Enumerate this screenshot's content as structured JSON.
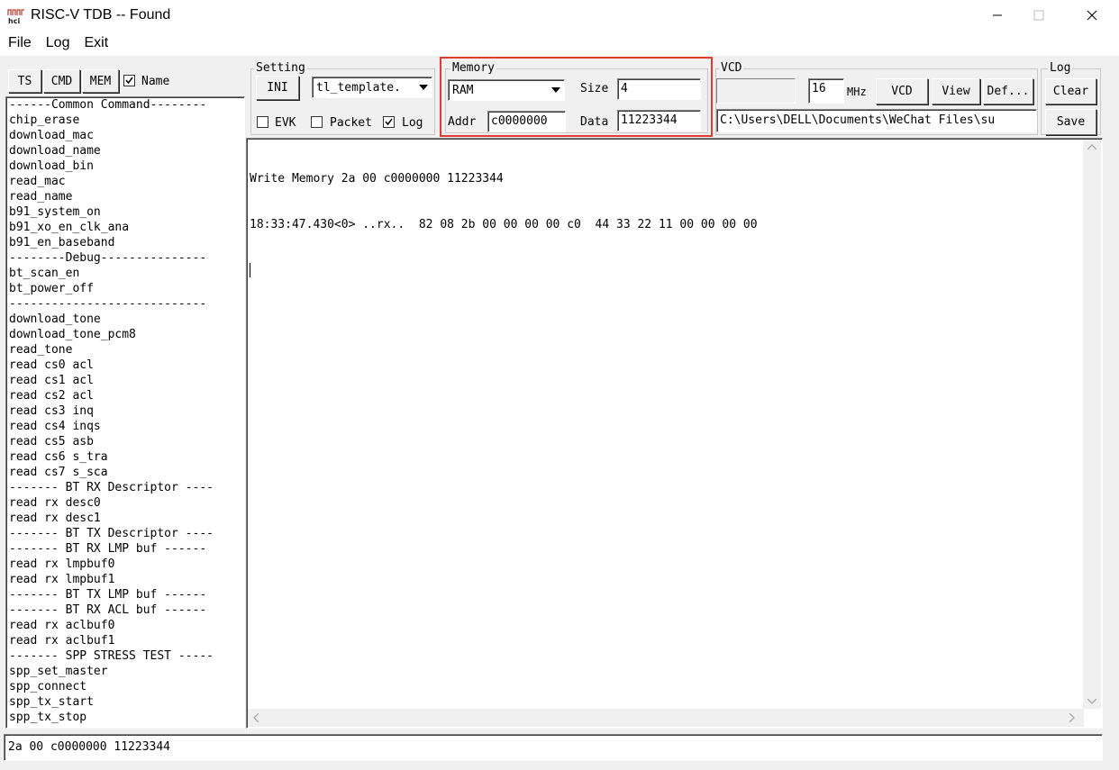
{
  "window": {
    "title": "RISC-V TDB -- Found",
    "icon": "hci-logo-icon",
    "controls": [
      "minimize-icon",
      "maximize-icon",
      "close-icon"
    ]
  },
  "menu": {
    "items": [
      "File",
      "Log",
      "Exit"
    ]
  },
  "left_panel": {
    "tabs": [
      "TS",
      "CMD",
      "MEM"
    ],
    "name_checkbox": {
      "label": "Name",
      "checked": true
    },
    "commands": [
      "------Common Command--------",
      "chip_erase",
      "download_mac",
      "download_name",
      "download_bin",
      "read_mac",
      "read_name",
      "b91_system_on",
      "b91_xo_en_clk_ana",
      "b91_en_baseband",
      "--------Debug---------------",
      "bt_scan_en",
      "bt_power_off",
      "----------------------------",
      "download_tone",
      "download_tone_pcm8",
      "read_tone",
      "read cs0 acl",
      "read cs1 acl",
      "read cs2 acl",
      "read cs3 inq",
      "read cs4 inqs",
      "read cs5 asb",
      "read cs6 s_tra",
      "read cs7 s_sca",
      "------- BT RX Descriptor ----",
      "read rx desc0",
      "read rx desc1",
      "------- BT TX Descriptor ----",
      "------- BT RX LMP buf ------",
      "read rx lmpbuf0",
      "read rx lmpbuf1",
      "------- BT TX LMP buf ------",
      "------- BT RX ACL buf ------",
      "read rx aclbuf0",
      "read rx aclbuf1",
      "------- SPP STRESS TEST -----",
      "spp_set_master",
      "spp_connect",
      "spp_tx_start",
      "spp_tx_stop"
    ]
  },
  "setting": {
    "label": "Setting",
    "ini_button": "INI",
    "template_value": "tl_template.",
    "evk": {
      "label": "EVK",
      "checked": false
    },
    "packet": {
      "label": "Packet",
      "checked": false
    },
    "log": {
      "label": "Log",
      "checked": true
    }
  },
  "memory": {
    "label": "Memory",
    "type_value": "RAM",
    "size_label": "Size",
    "size_value": "4",
    "addr_label": "Addr",
    "addr_value": "c0000000",
    "data_label": "Data",
    "data_value": "11223344",
    "highlight_color": "#e53935"
  },
  "vcd": {
    "label": "VCD",
    "freq_value": "16",
    "freq_unit": "MHz",
    "vcd_button": "VCD",
    "view_button": "View",
    "def_button": "Def...",
    "path_value": "C:\\Users\\DELL\\Documents\\WeChat Files\\su"
  },
  "log_group": {
    "label": "Log",
    "clear_button": "Clear",
    "save_button": "Save"
  },
  "log_output": {
    "lines": [
      "Write Memory 2a 00 c0000000 11223344",
      "18:33:47.430<0> ..rx..  82 08 2b 00 00 00 00 c0  44 33 22 11 00 00 00 00"
    ]
  },
  "command_input": {
    "value": "2a 00 c0000000 11223344"
  }
}
